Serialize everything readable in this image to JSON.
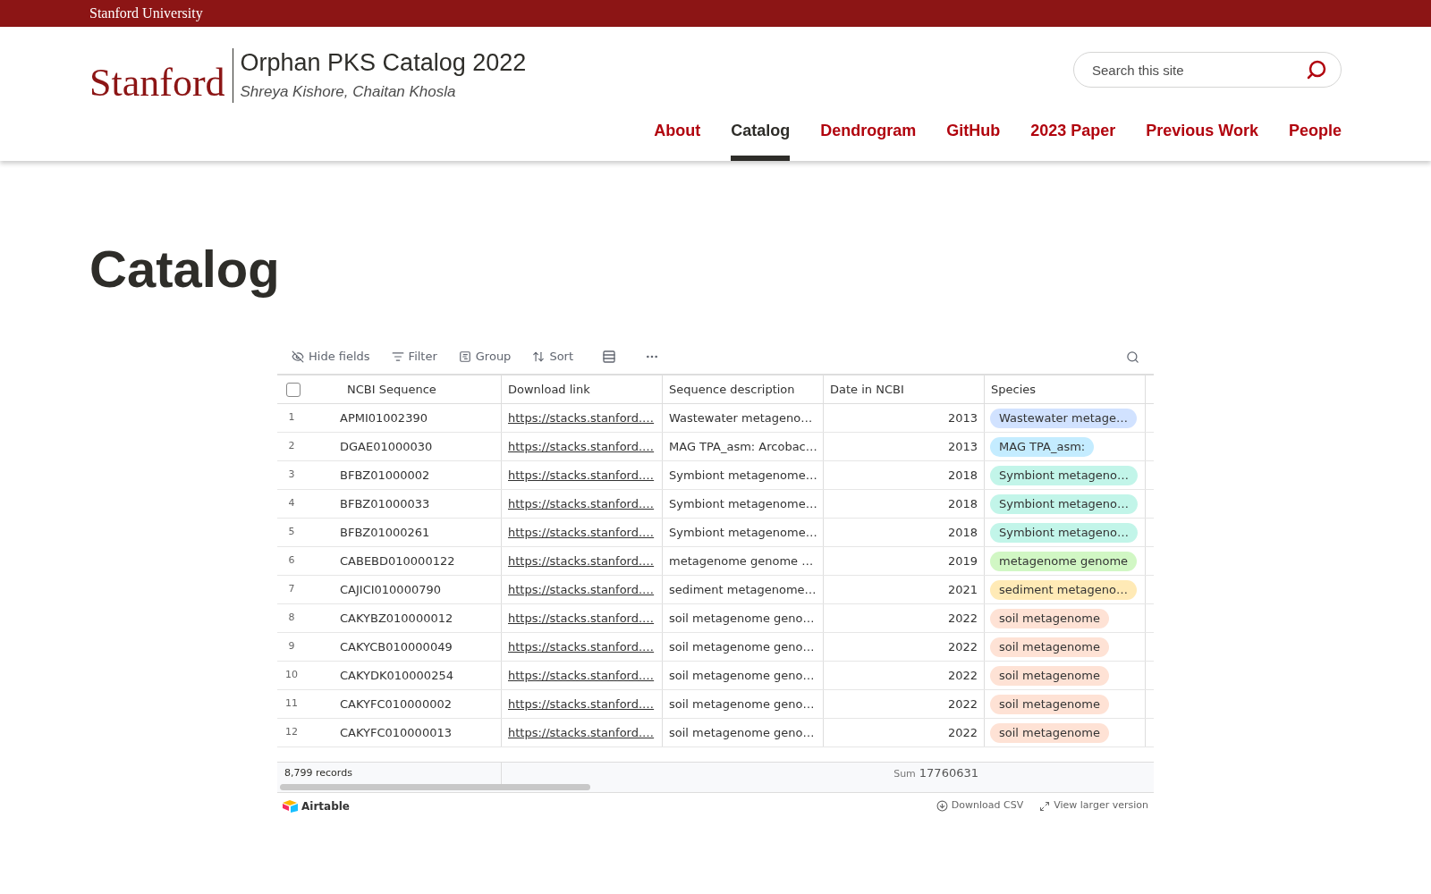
{
  "top_bar": {
    "title": "Stanford University"
  },
  "header": {
    "logo": "Stanford",
    "site_title": "Orphan PKS Catalog 2022",
    "authors": "Shreya Kishore, Chaitan Khosla",
    "search": {
      "placeholder": "Search this site"
    }
  },
  "nav": [
    {
      "label": "About",
      "selected": false
    },
    {
      "label": "Catalog",
      "selected": true
    },
    {
      "label": "Dendrogram",
      "selected": false
    },
    {
      "label": "GitHub",
      "selected": false
    },
    {
      "label": "2023 Paper",
      "selected": false
    },
    {
      "label": "Previous Work",
      "selected": false
    },
    {
      "label": "People",
      "selected": false
    }
  ],
  "page_title": "Catalog",
  "toolbar": [
    {
      "kind": "hide",
      "label": "Hide fields"
    },
    {
      "kind": "filter",
      "label": "Filter"
    },
    {
      "kind": "group",
      "label": "Group"
    },
    {
      "kind": "sort",
      "label": "Sort"
    },
    {
      "kind": "height"
    },
    {
      "kind": "more"
    }
  ],
  "table": {
    "select_all": {
      "checked": false
    },
    "columns": [
      "NCBI Sequence",
      "Download link",
      "Sequence description",
      "Date in NCBI",
      "Species"
    ],
    "rows": [
      {
        "number": "1",
        "ncbi_sequence": "APMI01002390",
        "download_link": "https://stacks.stanford.…",
        "sequence_description": "Wastewater metageno…",
        "date": "2013",
        "species": {
          "text": "Wastewater metage…",
          "color": "#d1e2ff"
        }
      },
      {
        "number": "2",
        "ncbi_sequence": "DGAE01000030",
        "download_link": "https://stacks.stanford.…",
        "sequence_description": "MAG TPA_asm: Arcobac…",
        "date": "2013",
        "species": {
          "text": "MAG TPA_asm:",
          "color": "#c4ecff"
        }
      },
      {
        "number": "3",
        "ncbi_sequence": "BFBZ01000002",
        "download_link": "https://stacks.stanford.…",
        "sequence_description": "Symbiont metagenome…",
        "date": "2018",
        "species": {
          "text": "Symbiont metageno…",
          "color": "#c2f5e9"
        }
      },
      {
        "number": "4",
        "ncbi_sequence": "BFBZ01000033",
        "download_link": "https://stacks.stanford.…",
        "sequence_description": "Symbiont metagenome…",
        "date": "2018",
        "species": {
          "text": "Symbiont metageno…",
          "color": "#c2f5e9"
        }
      },
      {
        "number": "5",
        "ncbi_sequence": "BFBZ01000261",
        "download_link": "https://stacks.stanford.…",
        "sequence_description": "Symbiont metagenome…",
        "date": "2018",
        "species": {
          "text": "Symbiont metageno…",
          "color": "#c2f5e9"
        }
      },
      {
        "number": "6",
        "ncbi_sequence": "CABEBD010000122",
        "download_link": "https://stacks.stanford.…",
        "sequence_description": "metagenome genome …",
        "date": "2019",
        "species": {
          "text": "metagenome genome",
          "color": "#d1f7c4"
        }
      },
      {
        "number": "7",
        "ncbi_sequence": "CAJICI010000790",
        "download_link": "https://stacks.stanford.…",
        "sequence_description": "sediment metagenome…",
        "date": "2021",
        "species": {
          "text": "sediment metageno…",
          "color": "#ffeab6"
        }
      },
      {
        "number": "8",
        "ncbi_sequence": "CAKYBZ010000012",
        "download_link": "https://stacks.stanford.…",
        "sequence_description": "soil metagenome geno…",
        "date": "2022",
        "species": {
          "text": "soil metagenome",
          "color": "#fee2d5"
        }
      },
      {
        "number": "9",
        "ncbi_sequence": "CAKYCB010000049",
        "download_link": "https://stacks.stanford.…",
        "sequence_description": "soil metagenome geno…",
        "date": "2022",
        "species": {
          "text": "soil metagenome",
          "color": "#fee2d5"
        }
      },
      {
        "number": "10",
        "ncbi_sequence": "CAKYDK010000254",
        "download_link": "https://stacks.stanford.…",
        "sequence_description": "soil metagenome geno…",
        "date": "2022",
        "species": {
          "text": "soil metagenome",
          "color": "#fee2d5"
        }
      },
      {
        "number": "11",
        "ncbi_sequence": "CAKYFC010000002",
        "download_link": "https://stacks.stanford.…",
        "sequence_description": "soil metagenome geno…",
        "date": "2022",
        "species": {
          "text": "soil metagenome",
          "color": "#fee2d5"
        }
      },
      {
        "number": "12",
        "ncbi_sequence": "CAKYFC010000013",
        "download_link": "https://stacks.stanford.…",
        "sequence_description": "soil metagenome geno…",
        "date": "2022",
        "species": {
          "text": "soil metagenome",
          "color": "#fee2d5"
        }
      }
    ],
    "record_count": "8,799 records",
    "sum_label": "Sum",
    "sum_value": "17760631"
  },
  "embed_footer": {
    "brand": "Airtable",
    "download": "Download CSV",
    "larger": "View larger version"
  }
}
